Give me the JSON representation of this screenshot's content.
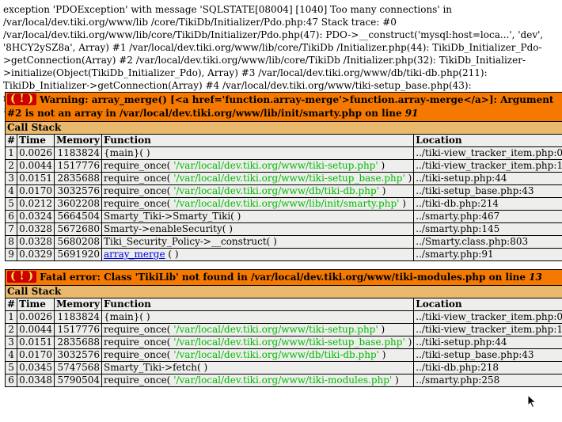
{
  "exception": {
    "text": "exception 'PDOException' with message 'SQLSTATE[08004] [1040] Too many connections' in /var/local/dev.tiki.org/www/lib /core/TikiDb/Initializer/Pdo.php:47 Stack trace: #0 /var/local/dev.tiki.org/www/lib/core/TikiDb/Initializer/Pdo.php(47): PDO->__construct('mysql:host=loca...', 'dev', '8HCY2ySZ8a', Array) #1 /var/local/dev.tiki.org/www/lib/core/TikiDb /Initializer.php(44): TikiDb_Initializer_Pdo->getConnection(Array) #2 /var/local/dev.tiki.org/www/lib/core/TikiDb /Initializer.php(32): TikiDb_Initializer->initialize(Object(TikiDb_Initializer_Pdo), Array) #3 /var/local/dev.tiki.org/www/db/tiki-db.php(211): TikiDb_Initializer->getConnection(Array) #4 /var/local/dev.tiki.org/www/tiki-setup_base.php(43): require_once('/var /local/dev....') #5 /var/local/dev.tiki.org/www/tiki-setup.php(44): require_once('/var/local/dev....') #6 /var/local/dev.tiki.org /www/tiki-view_tracker_item.php(12): require_once('/var/local/dev....') #7 {main}"
  },
  "warning": {
    "badge": "( ! )",
    "message": "Warning: array_merge() [<a href='function.array-merge'>function.array-merge</a>]: Argument #2 is not an array in /var/local/dev.tiki.org/www/lib/init/smarty.php on line ",
    "line": "91",
    "callstack_label": "Call Stack",
    "columns": [
      "#",
      "Time",
      "Memory",
      "Function",
      "Location"
    ],
    "rows": [
      {
        "n": "1",
        "time": "0.0026",
        "memory": "1183824",
        "func": "{main}( )",
        "arg": "",
        "tail": "",
        "location": "../tiki-view_tracker_item.php:0"
      },
      {
        "n": "2",
        "time": "0.0044",
        "memory": "1517776",
        "func": "require_once( ",
        "arg": "'/var/local/dev.tiki.org/www/tiki-setup.php'",
        "tail": " )",
        "location": "../tiki-view_tracker_item.php:12"
      },
      {
        "n": "3",
        "time": "0.0151",
        "memory": "2835688",
        "func": "require_once( ",
        "arg": "'/var/local/dev.tiki.org/www/tiki-setup_base.php'",
        "tail": " )",
        "location": "../tiki-setup.php:44"
      },
      {
        "n": "4",
        "time": "0.0170",
        "memory": "3032576",
        "func": "require_once( ",
        "arg": "'/var/local/dev.tiki.org/www/db/tiki-db.php'",
        "tail": " )",
        "location": "../tiki-setup_base.php:43"
      },
      {
        "n": "5",
        "time": "0.0212",
        "memory": "3602208",
        "func": "require_once( ",
        "arg": "'/var/local/dev.tiki.org/www/lib/init/smarty.php'",
        "tail": " )",
        "location": "../tiki-db.php:214"
      },
      {
        "n": "6",
        "time": "0.0324",
        "memory": "5664504",
        "func": "Smarty_Tiki->Smarty_Tiki( )",
        "arg": "",
        "tail": "",
        "location": "../smarty.php:467"
      },
      {
        "n": "7",
        "time": "0.0328",
        "memory": "5672680",
        "func": "Smarty->enableSecurity( )",
        "arg": "",
        "tail": "",
        "location": "../smarty.php:145"
      },
      {
        "n": "8",
        "time": "0.0328",
        "memory": "5680208",
        "func": "Tiki_Security_Policy->__construct( )",
        "arg": "",
        "tail": "",
        "location": "../Smarty.class.php:803"
      }
    ],
    "last_row": {
      "n": "9",
      "time": "0.0329",
      "memory": "5691920",
      "link": "array_merge",
      "tail": " ( )",
      "location": "../smarty.php:91"
    }
  },
  "fatal": {
    "badge": "( ! )",
    "message": "Fatal error: Class 'TikiLib' not found in /var/local/dev.tiki.org/www/tiki-modules.php on line ",
    "line": "13",
    "callstack_label": "Call Stack",
    "columns": [
      "#",
      "Time",
      "Memory",
      "Function",
      "Location"
    ],
    "rows": [
      {
        "n": "1",
        "time": "0.0026",
        "memory": "1183824",
        "func": "{main}( )",
        "arg": "",
        "tail": "",
        "location": "../tiki-view_tracker_item.php:0"
      },
      {
        "n": "2",
        "time": "0.0044",
        "memory": "1517776",
        "func": "require_once( ",
        "arg": "'/var/local/dev.tiki.org/www/tiki-setup.php'",
        "tail": " )",
        "location": "../tiki-view_tracker_item.php:12"
      },
      {
        "n": "3",
        "time": "0.0151",
        "memory": "2835688",
        "func": "require_once( ",
        "arg": "'/var/local/dev.tiki.org/www/tiki-setup_base.php'",
        "tail": " )",
        "location": "../tiki-setup.php:44"
      },
      {
        "n": "4",
        "time": "0.0170",
        "memory": "3032576",
        "func": "require_once( ",
        "arg": "'/var/local/dev.tiki.org/www/db/tiki-db.php'",
        "tail": " )",
        "location": "../tiki-setup_base.php:43"
      },
      {
        "n": "5",
        "time": "0.0345",
        "memory": "5747568",
        "func": "Smarty_Tiki->fetch( )",
        "arg": "",
        "tail": "",
        "location": "../tiki-db.php:218"
      },
      {
        "n": "6",
        "time": "0.0348",
        "memory": "5790504",
        "func": "require_once( ",
        "arg": "'/var/local/dev.tiki.org/www/tiki-modules.php'",
        "tail": " )",
        "location": "../smarty.php:258"
      }
    ]
  },
  "cursor": {
    "icon": "mouse-pointer-icon"
  },
  "colors": {
    "error_header": "#f57900",
    "badge_bg": "#cc0000",
    "badge_fg": "#fce94f",
    "callstack_header": "#e9b96e",
    "cell_bg": "#eeeeec",
    "path_arg": "#00bb00",
    "link": "#0000ee"
  }
}
